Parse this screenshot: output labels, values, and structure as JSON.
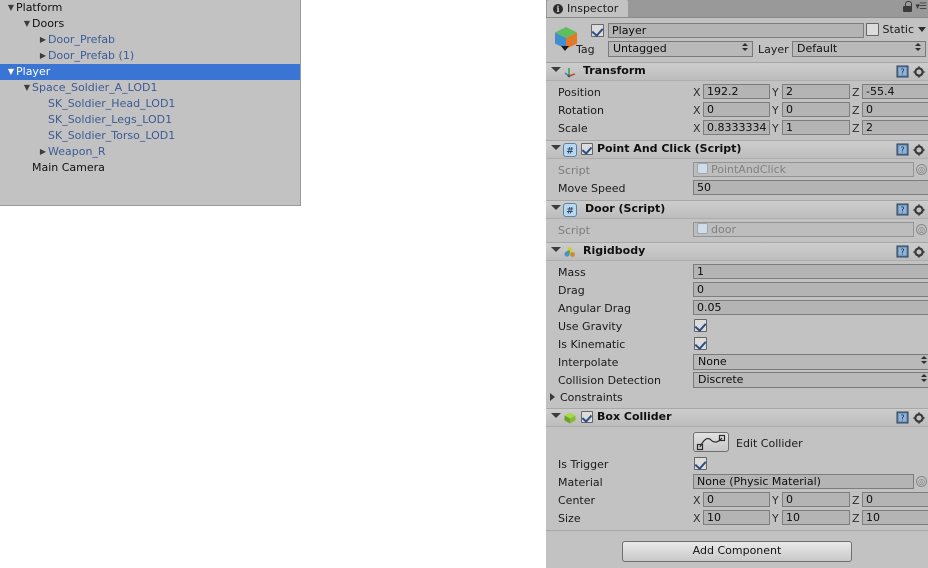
{
  "hierarchy": {
    "rows": [
      {
        "label": "Platform",
        "depth": 0,
        "arrow": "down",
        "prefab": false,
        "selected": false
      },
      {
        "label": "Doors",
        "depth": 1,
        "arrow": "down",
        "prefab": false,
        "selected": false
      },
      {
        "label": "Door_Prefab",
        "depth": 2,
        "arrow": "right",
        "prefab": true,
        "selected": false
      },
      {
        "label": "Door_Prefab (1)",
        "depth": 2,
        "arrow": "right",
        "prefab": true,
        "selected": false
      },
      {
        "label": "Player",
        "depth": 0,
        "arrow": "down",
        "prefab": false,
        "selected": true
      },
      {
        "label": "Space_Soldier_A_LOD1",
        "depth": 1,
        "arrow": "down",
        "prefab": true,
        "selected": false
      },
      {
        "label": "SK_Soldier_Head_LOD1",
        "depth": 2,
        "arrow": "none",
        "prefab": true,
        "selected": false
      },
      {
        "label": "SK_Soldier_Legs_LOD1",
        "depth": 2,
        "arrow": "none",
        "prefab": true,
        "selected": false
      },
      {
        "label": "SK_Soldier_Torso_LOD1",
        "depth": 2,
        "arrow": "none",
        "prefab": true,
        "selected": false
      },
      {
        "label": "Weapon_R",
        "depth": 2,
        "arrow": "right",
        "prefab": true,
        "selected": false
      },
      {
        "label": "Main Camera",
        "depth": 1,
        "arrow": "none",
        "prefab": false,
        "selected": false
      }
    ]
  },
  "inspector": {
    "tab_label": "Inspector",
    "object": {
      "enabled": true,
      "name": "Player",
      "static_label": "Static",
      "static_checked": false,
      "tag_label": "Tag",
      "tag_value": "Untagged",
      "layer_label": "Layer",
      "layer_value": "Default"
    },
    "transform": {
      "title": "Transform",
      "position_label": "Position",
      "position": {
        "x": "192.2",
        "y": "2",
        "z": "-55.4"
      },
      "rotation_label": "Rotation",
      "rotation": {
        "x": "0",
        "y": "0",
        "z": "0"
      },
      "scale_label": "Scale",
      "scale": {
        "x": "0.8333334",
        "y": "1",
        "z": "2"
      }
    },
    "point_and_click": {
      "title": "Point And Click (Script)",
      "enabled": true,
      "script_label": "Script",
      "script_value": "PointAndClick",
      "move_speed_label": "Move Speed",
      "move_speed_value": "50"
    },
    "door_script": {
      "title": "Door (Script)",
      "script_label": "Script",
      "script_value": "door"
    },
    "rigidbody": {
      "title": "Rigidbody",
      "mass_label": "Mass",
      "mass_value": "1",
      "drag_label": "Drag",
      "drag_value": "0",
      "angular_drag_label": "Angular Drag",
      "angular_drag_value": "0.05",
      "use_gravity_label": "Use Gravity",
      "use_gravity_checked": true,
      "is_kinematic_label": "Is Kinematic",
      "is_kinematic_checked": true,
      "interpolate_label": "Interpolate",
      "interpolate_value": "None",
      "collision_detection_label": "Collision Detection",
      "collision_detection_value": "Discrete",
      "constraints_label": "Constraints"
    },
    "box_collider": {
      "title": "Box Collider",
      "enabled": true,
      "edit_collider_label": "Edit Collider",
      "is_trigger_label": "Is Trigger",
      "is_trigger_checked": true,
      "material_label": "Material",
      "material_value": "None (Physic Material)",
      "center_label": "Center",
      "center": {
        "x": "0",
        "y": "0",
        "z": "0"
      },
      "size_label": "Size",
      "size": {
        "x": "10",
        "y": "10",
        "z": "10"
      }
    },
    "add_component_label": "Add Component",
    "axis_labels": {
      "x": "X",
      "y": "Y",
      "z": "Z"
    }
  },
  "colors": {
    "panel_bg": "#c2c2c2",
    "selection_blue": "#3a74d4",
    "prefab_text": "#3c5a96",
    "field_bg": "#b4b4b4"
  }
}
